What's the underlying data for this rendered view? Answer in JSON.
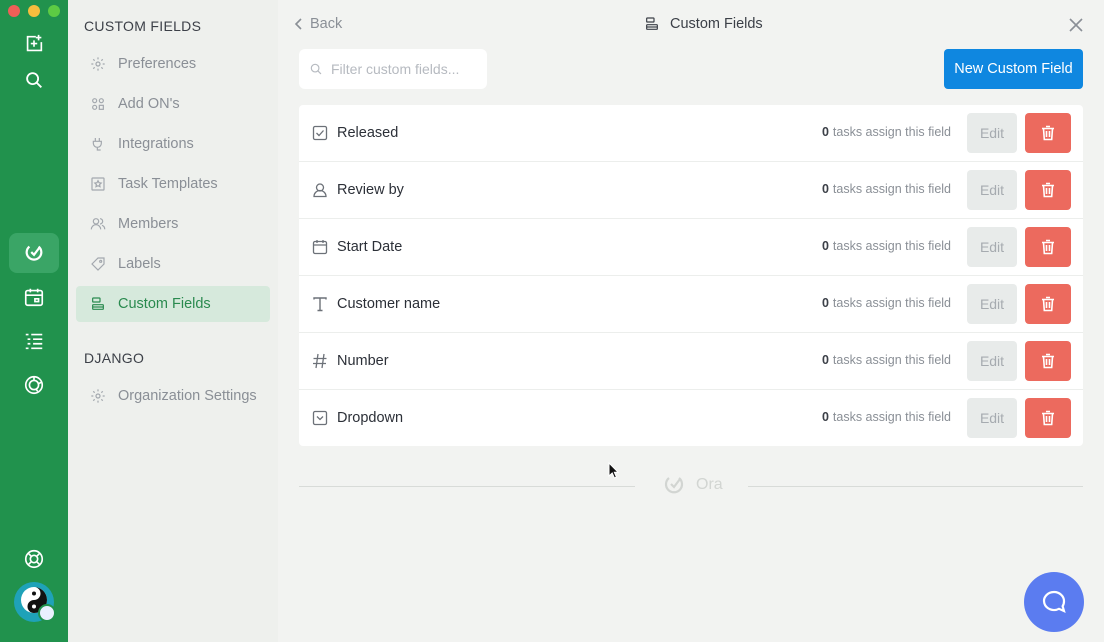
{
  "sidebar": {
    "section_custom_fields": "CUSTOM FIELDS",
    "items": [
      {
        "label": "Preferences",
        "icon": "gear-icon"
      },
      {
        "label": "Add ON's",
        "icon": "grid-icon"
      },
      {
        "label": "Integrations",
        "icon": "plug-icon"
      },
      {
        "label": "Task Templates",
        "icon": "star-template-icon"
      },
      {
        "label": "Members",
        "icon": "users-icon"
      },
      {
        "label": "Labels",
        "icon": "tag-icon"
      },
      {
        "label": "Custom Fields",
        "icon": "fields-icon",
        "active": true
      }
    ],
    "section_org": "DJANGO",
    "org_items": [
      {
        "label": "Organization Settings",
        "icon": "gear-icon"
      }
    ]
  },
  "header": {
    "back_label": "Back",
    "title": "Custom Fields"
  },
  "toolbar": {
    "filter_placeholder": "Filter custom fields...",
    "new_button_label": "New Custom Field"
  },
  "fields": [
    {
      "name": "Released",
      "icon": "checkbox-icon",
      "count": "0",
      "count_suffix": "tasks assign this field",
      "edit_label": "Edit"
    },
    {
      "name": "Review by",
      "icon": "person-icon",
      "count": "0",
      "count_suffix": "tasks assign this field",
      "edit_label": "Edit"
    },
    {
      "name": "Start Date",
      "icon": "calendar-icon",
      "count": "0",
      "count_suffix": "tasks assign this field",
      "edit_label": "Edit"
    },
    {
      "name": "Customer name",
      "icon": "text-icon",
      "count": "0",
      "count_suffix": "tasks assign this field",
      "edit_label": "Edit"
    },
    {
      "name": "Number",
      "icon": "hash-icon",
      "count": "0",
      "count_suffix": "tasks assign this field",
      "edit_label": "Edit"
    },
    {
      "name": "Dropdown",
      "icon": "dropdown-icon",
      "count": "0",
      "count_suffix": "tasks assign this field",
      "edit_label": "Edit"
    }
  ],
  "footer": {
    "logo_text": "Ora"
  },
  "colors": {
    "rail": "#21924d",
    "primary_button": "#0f87e0",
    "delete_button": "#ec6a5e",
    "active_nav": "#d6e9dc",
    "chat_bubble": "#5b7cf0"
  }
}
